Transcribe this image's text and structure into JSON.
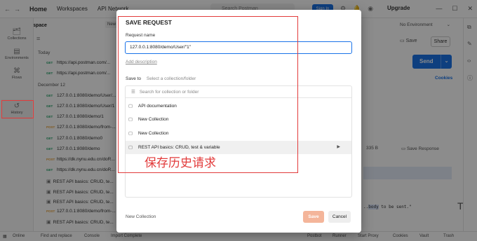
{
  "topbar": {
    "nav_home": "Home",
    "nav_workspaces": "Workspaces",
    "nav_api": "API Network",
    "search_placeholder": "Search Postman",
    "signin": "Sign In",
    "upgrade": "Upgrade"
  },
  "workspace": {
    "name": "My Workspace",
    "new_label": "New"
  },
  "rail": [
    {
      "label": "Collections",
      "icon": "collections-icon"
    },
    {
      "label": "Environments",
      "icon": "environments-icon"
    },
    {
      "label": "Flows",
      "icon": "flows-icon"
    },
    {
      "label": "History",
      "icon": "history-icon"
    }
  ],
  "history": {
    "group_today": "Today",
    "group_dec12": "December 12",
    "rows": [
      {
        "method": "GET",
        "text": "https://api.postman.com/..."
      },
      {
        "method": "GET",
        "text": "https://api.postman.com/..."
      },
      {
        "method": "GET",
        "text": "127.0.0.1:8080/demo/User/..."
      },
      {
        "method": "GET",
        "text": "127.0.0.1:8080/demo/User/1"
      },
      {
        "method": "GET",
        "text": "127.0.0.1:8080/demo/1"
      },
      {
        "method": "POST",
        "text": "127.0.0.1:8080/demo/from-..."
      },
      {
        "method": "GET",
        "text": "127.0.0.1:8080/demo0"
      },
      {
        "method": "GET",
        "text": "127.0.0.1:8080/demo"
      },
      {
        "method": "POST",
        "text": "https://dk.nynu.edu.cn/doR..."
      },
      {
        "method": "GET",
        "text": "https://dk.nynu.edu.cn/doR..."
      },
      {
        "method": "",
        "text": "REST API basics: CRUD, te..."
      },
      {
        "method": "",
        "text": "REST API basics: CRUD, te..."
      },
      {
        "method": "",
        "text": "REST API basics: CRUD, te..."
      },
      {
        "method": "POST",
        "text": "127.0.0.1:8080/demo/from-..."
      },
      {
        "method": "",
        "text": "REST API basics: CRUD, te..."
      }
    ]
  },
  "main": {
    "environment": "No Environment",
    "save_label": "Save",
    "share_label": "Share",
    "send_label": "Send",
    "cookies_label": "Cookies",
    "resp_size": "335 B",
    "save_response": "Save Response",
    "code_text_pre": "..",
    "code_text_hl": "body",
    "code_text_post": " to be sent.\""
  },
  "statusbar": {
    "online": "Online",
    "find_replace": "Find and replace",
    "console": "Console",
    "import": "Import Complete",
    "postbot": "Postbot",
    "runner": "Runner",
    "start_proxy": "Start Proxy",
    "cookies": "Cookies",
    "vault": "Vault",
    "trash": "Trash"
  },
  "modal": {
    "title": "SAVE REQUEST",
    "request_name_label": "Request name",
    "request_name_value": "127.0.0.1:8080/demo/User/\"1\"",
    "add_description": "Add description",
    "save_to_label": "Save to",
    "save_to_placeholder": "Select a collection/folder",
    "search_placeholder": "Search for collection or folder",
    "collections": [
      {
        "label": "API documentation",
        "selected": false
      },
      {
        "label": "New Collection",
        "selected": false
      },
      {
        "label": "New Collection",
        "selected": false
      },
      {
        "label": "REST API basics: CRUD, test & variable",
        "selected": true
      }
    ],
    "new_collection": "New Collection",
    "save_button": "Save",
    "cancel_button": "Cancel"
  },
  "annotation": {
    "text": "保存历史请求",
    "color": "#e23b3b"
  }
}
